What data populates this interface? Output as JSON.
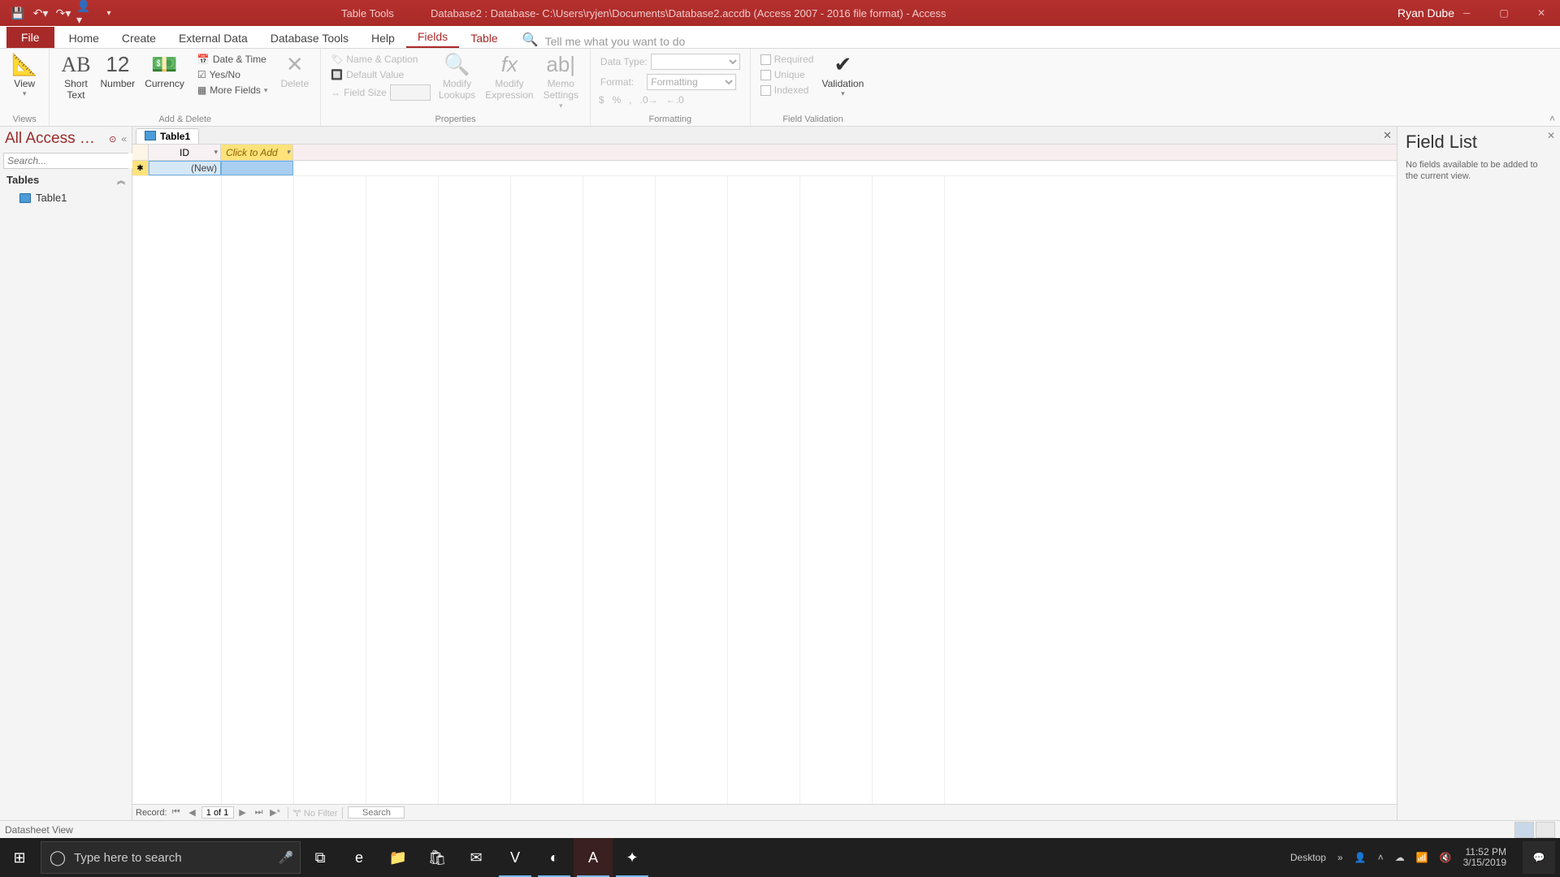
{
  "titlebar": {
    "table_tools": "Table Tools",
    "doc_title": "Database2 : Database- C:\\Users\\ryjen\\Documents\\Database2.accdb (Access 2007 - 2016 file format)  -  Access",
    "user": "Ryan Dube"
  },
  "tabs": {
    "file": "File",
    "home": "Home",
    "create": "Create",
    "external": "External Data",
    "dbtools": "Database Tools",
    "help": "Help",
    "fields": "Fields",
    "table": "Table",
    "search_placeholder": "Tell me what you want to do"
  },
  "ribbon": {
    "views": {
      "label": "Views",
      "view": "View"
    },
    "add_delete": {
      "label": "Add & Delete",
      "short_text": "Short\nText",
      "number": "Number",
      "currency": "Currency",
      "date_time": "Date & Time",
      "yes_no": "Yes/No",
      "more_fields": "More Fields",
      "delete": "Delete"
    },
    "properties": {
      "label": "Properties",
      "name_caption": "Name & Caption",
      "default_value": "Default Value",
      "field_size": "Field Size",
      "modify_lookups": "Modify\nLookups",
      "modify_expression": "Modify\nExpression",
      "memo_settings": "Memo\nSettings"
    },
    "formatting": {
      "label": "Formatting",
      "data_type": "Data Type:",
      "format": "Format:",
      "format_value": "Formatting"
    },
    "validation": {
      "label": "Field Validation",
      "required": "Required",
      "unique": "Unique",
      "indexed": "Indexed",
      "validation": "Validation"
    }
  },
  "nav": {
    "header": "All Access …",
    "search_placeholder": "Search...",
    "group_tables": "Tables",
    "items": [
      "Table1"
    ]
  },
  "doc": {
    "tab": "Table1",
    "col_id": "ID",
    "col_add": "Click to Add",
    "row_new": "(New)",
    "recnav": {
      "label": "Record:",
      "pos": "1 of 1",
      "no_filter": "No Filter",
      "search": "Search"
    }
  },
  "fieldlist": {
    "title": "Field List",
    "empty": "No fields available to be added to the current view."
  },
  "statusbar": {
    "view": "Datasheet View"
  },
  "winbar": {
    "search_placeholder": "Type here to search",
    "desktop": "Desktop",
    "time": "11:52 PM",
    "date": "3/15/2019"
  }
}
